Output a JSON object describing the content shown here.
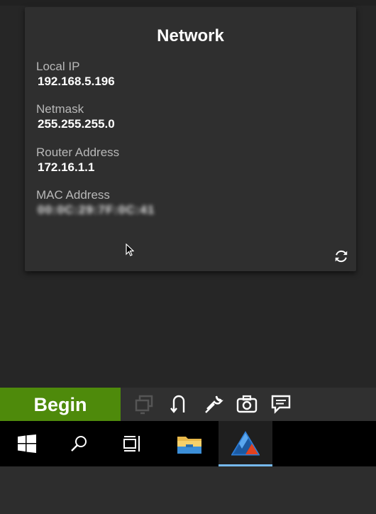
{
  "network_card": {
    "title": "Network",
    "fields": [
      {
        "label": "Local IP",
        "value": "192.168.5.196"
      },
      {
        "label": "Netmask",
        "value": "255.255.255.0"
      },
      {
        "label": "Router Address",
        "value": "172.16.1.1"
      },
      {
        "label": "MAC Address",
        "value": "00:0C:29:7F:0C:41"
      }
    ],
    "refresh_icon": "refresh-icon"
  },
  "toolbar": {
    "begin_label": "Begin",
    "tools": [
      "windows-icon-disabled",
      "undo-arrow-icon",
      "wrench-icon",
      "camera-icon",
      "chat-icon"
    ]
  },
  "taskbar": {
    "items": [
      "windows-start-icon",
      "search-icon",
      "task-view-icon",
      "file-explorer-icon",
      "app-logo-icon"
    ]
  },
  "colors": {
    "begin_green": "#4e8a0b",
    "card_bg": "#2f2f2f",
    "taskbar_accent": "#76b9ed"
  }
}
